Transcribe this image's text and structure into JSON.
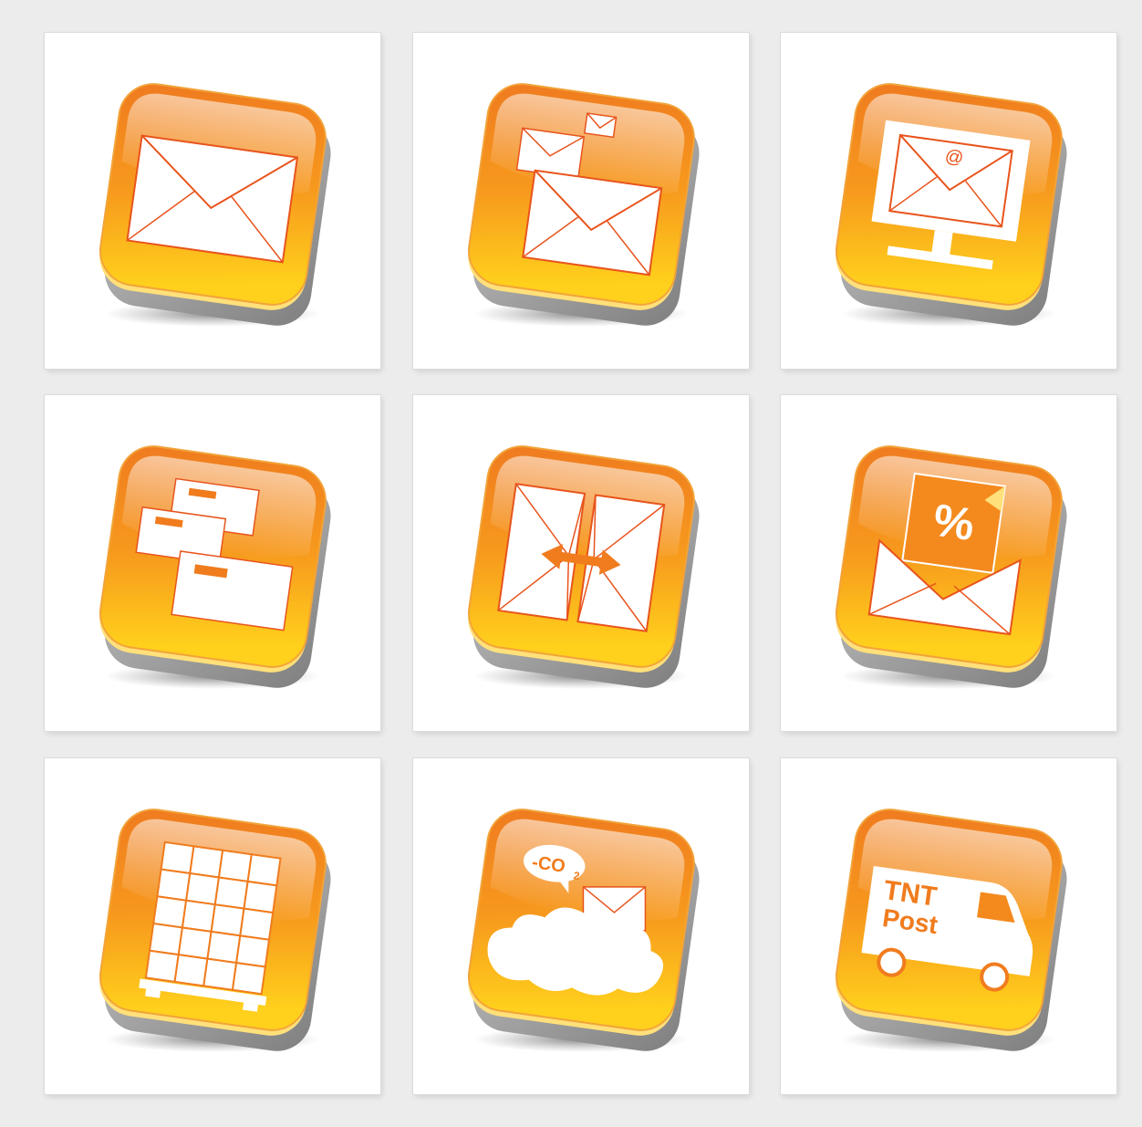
{
  "colors": {
    "background": "#ececec",
    "card": "#ffffff",
    "orange_dark": "#f07c1e",
    "orange_light": "#ffd21a",
    "icon_line": "#e8541c",
    "base_grey": "#9a9a9a"
  },
  "tiles": [
    {
      "icon": "envelope-icon"
    },
    {
      "icon": "multiple-envelopes-icon"
    },
    {
      "icon": "email-monitor-icon"
    },
    {
      "icon": "stacked-letters-icon"
    },
    {
      "icon": "exchange-envelopes-icon"
    },
    {
      "icon": "discount-envelope-icon"
    },
    {
      "icon": "pallet-boxes-icon"
    },
    {
      "icon": "co2-cloud-envelope-icon",
      "text": {
        "co2_label": "-CO",
        "co2_sub": "2"
      }
    },
    {
      "icon": "tnt-post-van-icon",
      "text": {
        "van_line1": "TNT",
        "van_line2": "Post"
      }
    }
  ],
  "symbols": {
    "at_sign": "@",
    "percent": "%"
  }
}
